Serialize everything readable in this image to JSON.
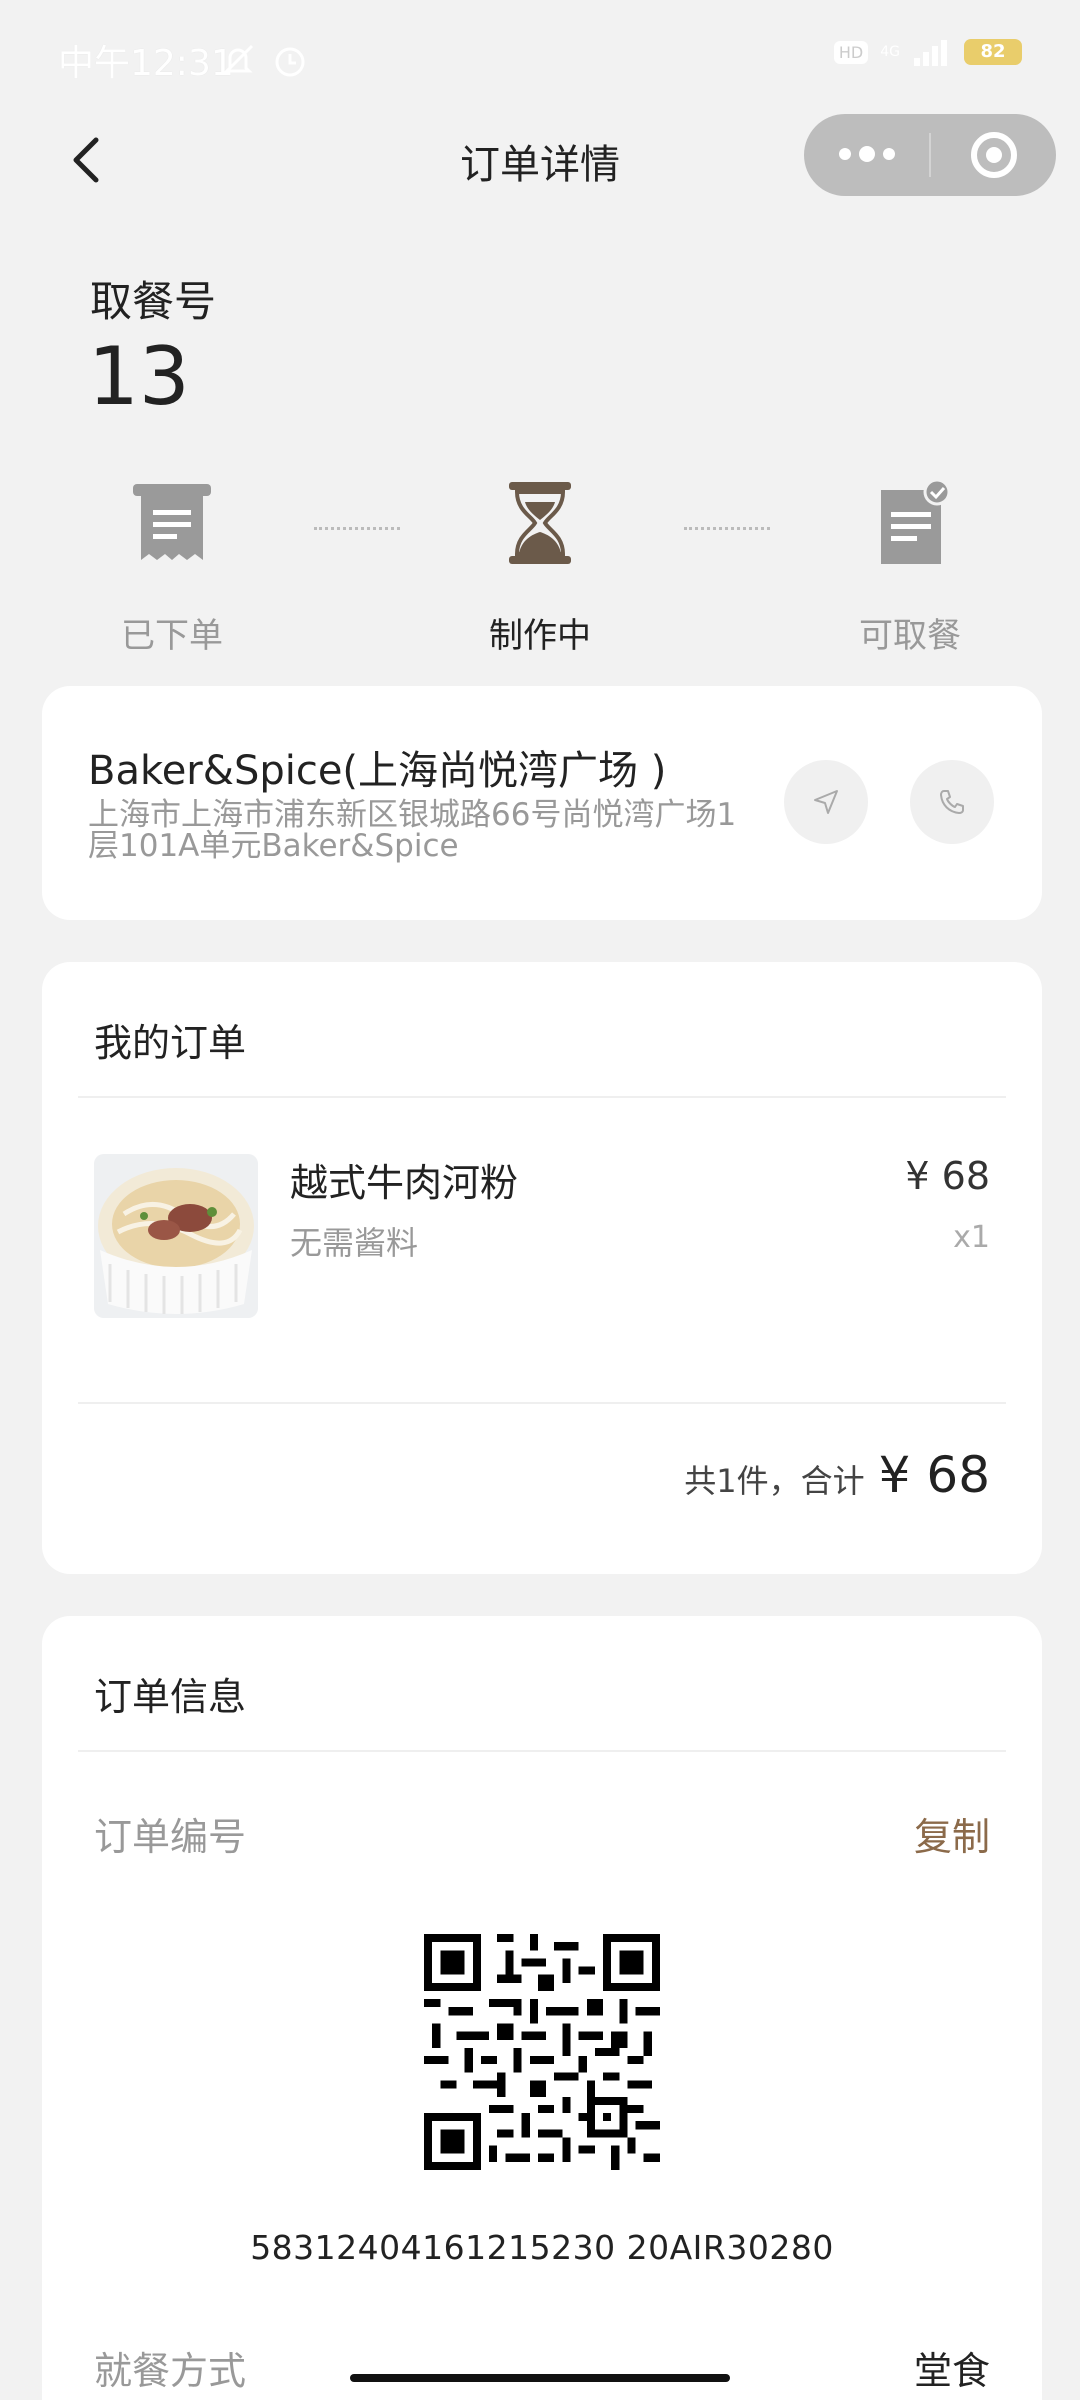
{
  "status_bar": {
    "time": "中午12:31",
    "hd": "HD",
    "network": "4G",
    "battery": "82"
  },
  "nav": {
    "title": "订单详情"
  },
  "pickup": {
    "label": "取餐号",
    "number": "13"
  },
  "steps": [
    {
      "label": "已下单",
      "icon": "receipt-icon"
    },
    {
      "label": "制作中",
      "icon": "hourglass-icon"
    },
    {
      "label": "可取餐",
      "icon": "ready-document-icon"
    }
  ],
  "store": {
    "name": "Baker&Spice(上海尚悦湾广场 )",
    "address": "上海市上海市浦东新区银城路66号尚悦湾广场1层101A单元Baker&Spice"
  },
  "order": {
    "title": "我的订单",
    "items": [
      {
        "name": "越式牛肉河粉",
        "option": "无需酱料",
        "price": "¥ 68",
        "qty": "x1"
      }
    ],
    "total_label": "共1件，合计",
    "total_value": "¥ 68"
  },
  "order_info": {
    "title": "订单信息",
    "order_no_label": "订单编号",
    "copy_label": "复制",
    "order_no": "58312404161215230 20AIR30280",
    "dining_label": "就餐方式",
    "dining_value": "堂食"
  },
  "colors": {
    "accent": "#8b6a4a",
    "active_icon": "#6b5a4a",
    "inactive_icon": "#9a9a9a"
  }
}
